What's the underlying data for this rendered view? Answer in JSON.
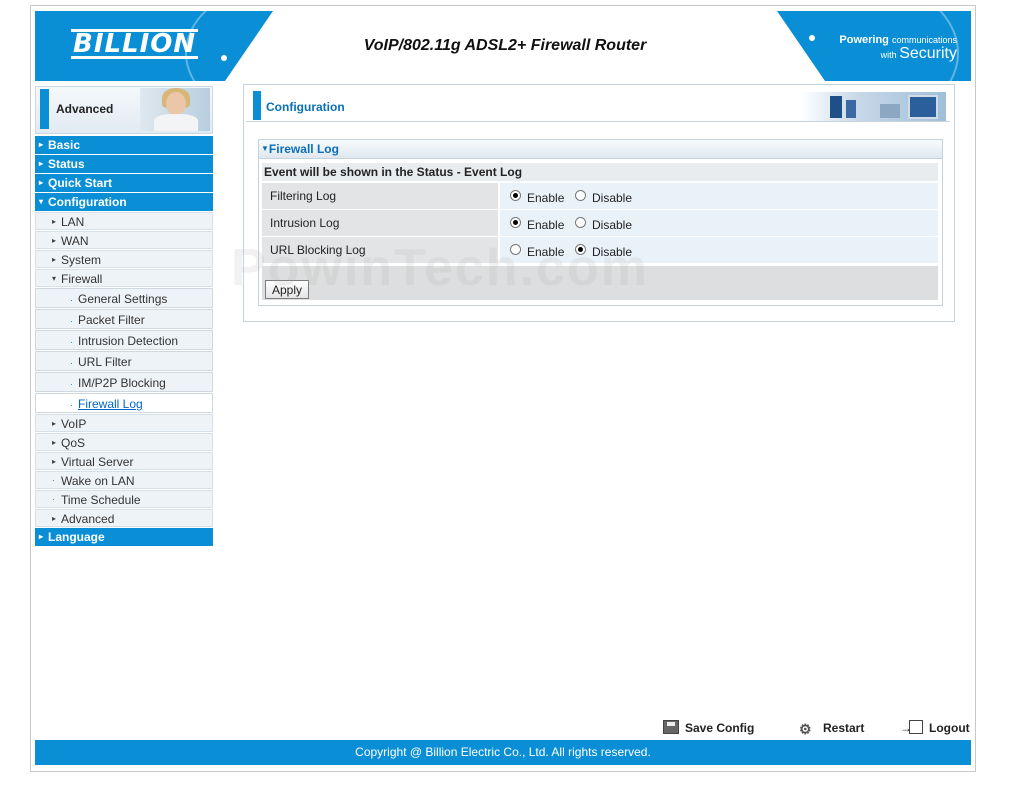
{
  "header": {
    "logo": "BILLION",
    "title": "VoIP/802.11g ADSL2+ Firewall Router",
    "tagline_1a": "Powering",
    "tagline_1b": "communications",
    "tagline_2a": "with",
    "tagline_2b": "Security"
  },
  "sidebar": {
    "mode_label": "Advanced",
    "top_items": [
      "Basic",
      "Status",
      "Quick Start",
      "Configuration"
    ],
    "config_items": [
      "LAN",
      "WAN",
      "System",
      "Firewall"
    ],
    "firewall_items": [
      "General Settings",
      "Packet Filter",
      "Intrusion Detection",
      "URL Filter",
      "IM/P2P Blocking",
      "Firewall Log"
    ],
    "more_items": [
      "VoIP",
      "QoS",
      "Virtual Server",
      "Wake on LAN",
      "Time Schedule",
      "Advanced"
    ],
    "last_item": "Language"
  },
  "panel": {
    "title": "Configuration",
    "section_title": "Firewall Log",
    "info": "Event will be shown in the Status - Event Log",
    "rows": [
      {
        "label": "Filtering Log",
        "enable": "Enable",
        "disable": "Disable",
        "selected": "enable"
      },
      {
        "label": "Intrusion Log",
        "enable": "Enable",
        "disable": "Disable",
        "selected": "enable"
      },
      {
        "label": "URL Blocking Log",
        "enable": "Enable",
        "disable": "Disable",
        "selected": "disable"
      }
    ],
    "apply_label": "Apply"
  },
  "watermark": "PowinTech.com",
  "actions": {
    "save": "Save Config",
    "restart": "Restart",
    "logout": "Logout"
  },
  "footer": "Copyright @ Billion Electric Co., Ltd. All rights reserved."
}
